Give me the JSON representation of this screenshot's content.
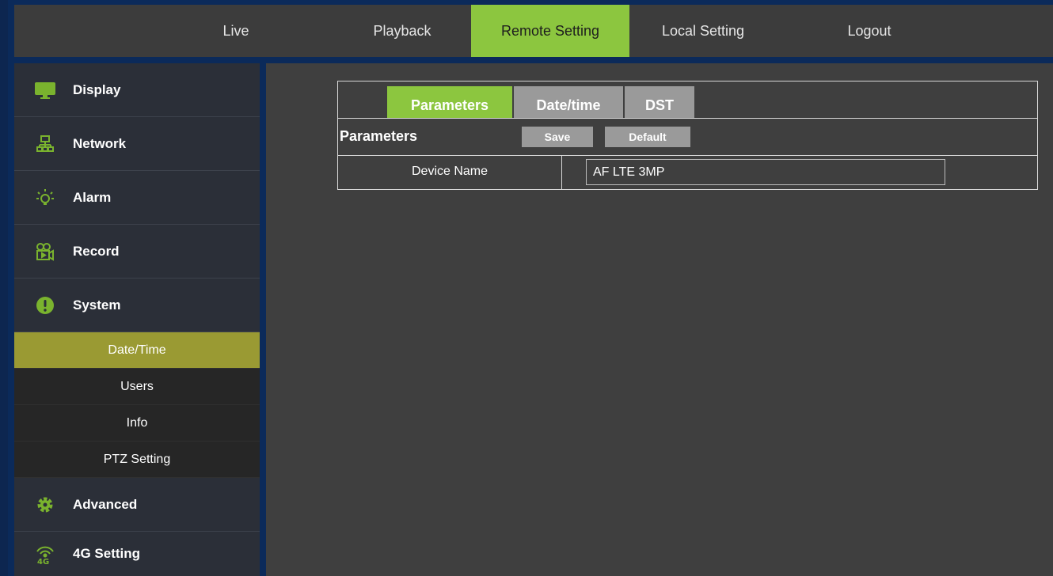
{
  "topnav": {
    "items": [
      {
        "label": "Live",
        "active": false
      },
      {
        "label": "Playback",
        "active": false
      },
      {
        "label": "Remote Setting",
        "active": true
      },
      {
        "label": "Local Setting",
        "active": false
      },
      {
        "label": "Logout",
        "active": false
      }
    ]
  },
  "sidebar": {
    "items": [
      {
        "label": "Display",
        "icon": "monitor-icon"
      },
      {
        "label": "Network",
        "icon": "network-icon"
      },
      {
        "label": "Alarm",
        "icon": "bulb-icon"
      },
      {
        "label": "Record",
        "icon": "camera-icon"
      },
      {
        "label": "System",
        "icon": "exclamation-icon"
      }
    ],
    "sub_items": [
      {
        "label": "Date/Time",
        "active": true
      },
      {
        "label": "Users",
        "active": false
      },
      {
        "label": "Info",
        "active": false
      },
      {
        "label": "PTZ Setting",
        "active": false
      }
    ],
    "bottom_items": [
      {
        "label": "Advanced",
        "icon": "gear-icon"
      },
      {
        "label": "4G Setting",
        "icon": "4g-signal-icon"
      }
    ]
  },
  "panel": {
    "tabs": [
      {
        "label": "Parameters",
        "active": true
      },
      {
        "label": "Date/time",
        "active": false
      },
      {
        "label": "DST",
        "active": false
      }
    ],
    "section_title": "Parameters",
    "save_label": "Save",
    "default_label": "Default",
    "device_name_label": "Device Name",
    "device_name_value": "AF LTE 3MP"
  },
  "colors": {
    "accent": "#8cc63f",
    "sidebar_active": "#9a9a33",
    "icon_green": "#7ab32e"
  }
}
